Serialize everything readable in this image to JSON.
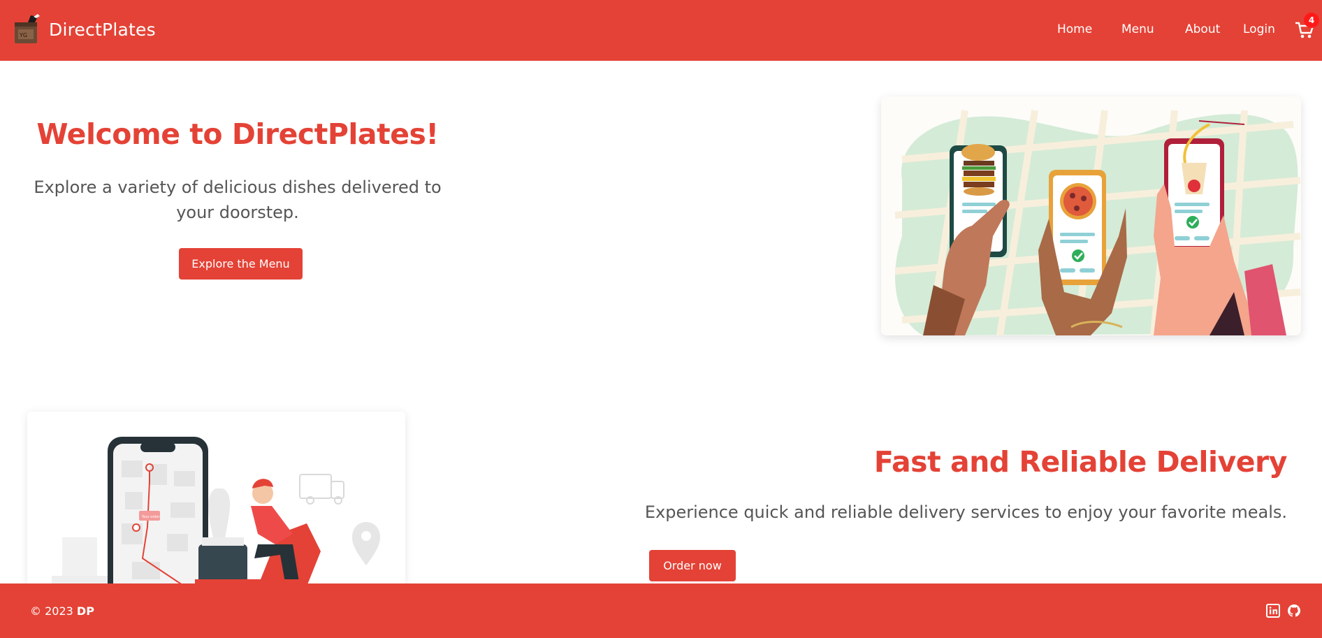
{
  "brand": {
    "name": "DirectPlates",
    "logo": "food-bag-logo"
  },
  "nav": {
    "links": [
      "Home",
      "Menu",
      "About",
      "Login"
    ],
    "cart_icon": "shopping-cart-icon",
    "cart_count": "4"
  },
  "hero": {
    "title": "Welcome to DirectPlates!",
    "subtitle": "Explore a variety of delicious dishes delivered to your doorstep.",
    "button": "Explore the Menu",
    "illustration": "hands-holding-phones-food-order"
  },
  "delivery": {
    "title": "Fast and Reliable Delivery",
    "subtitle": "Experience quick and reliable delivery services to enjoy your favorite meals.",
    "button": "Order now",
    "illustration": "delivery-scooter-map-phone",
    "map_label": "Your order"
  },
  "footer": {
    "copyright_prefix": "© 2023",
    "copyright_brand": "DP",
    "icons": [
      "linkedin-icon",
      "github-icon"
    ]
  },
  "colors": {
    "primary": "#e44236",
    "text": "#555555",
    "badge": "#ff1a1a"
  }
}
